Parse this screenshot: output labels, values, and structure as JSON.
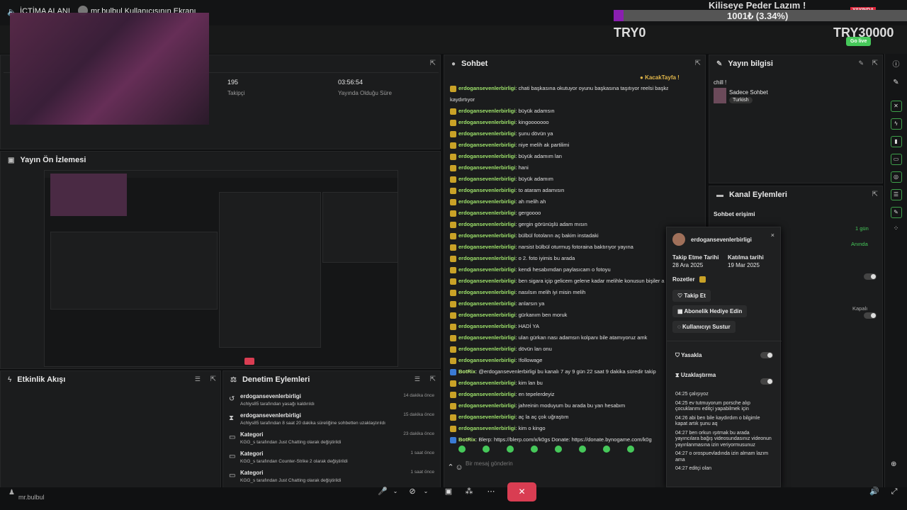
{
  "topbar": {
    "title": "İCTİMA ALANI",
    "user_screen": "mr.bulbul Kullanıcısının Ekranı"
  },
  "overlay": {
    "banner": "Kiliseye Peder Lazım !",
    "goal": "1001₺ (3.34%)",
    "left_amount": "TRY0",
    "right_amount": "TRY30000",
    "go_live": "Go live",
    "yayinda": "YAYINDA"
  },
  "stats": {
    "followers_value": "195",
    "followers_label": "Takipçi",
    "duration_value": "03:56:54",
    "duration_label": "Yayında Olduğu Süre"
  },
  "panels": {
    "preview_title": "Yayın Ön İzlemesi",
    "activity_title": "Etkinlik Akışı",
    "moderation_title": "Denetim Eylemleri",
    "chat_title": "Sohbet",
    "info_title": "Yayın bilgisi",
    "channel_actions_title": "Kanal Eylemleri"
  },
  "chat": {
    "pinned_user": "KacakTayfa",
    "placeholder": "Bir mesaj gönderin",
    "messages": [
      {
        "user": "erdogansevenlerbirligi",
        "text": "chati başkasına okutuyor oyunu başkasına taşıtıyor reelsi başkasına"
      },
      {
        "user": "",
        "text": "kaydırtıyor"
      },
      {
        "user": "erdogansevenlerbirligi",
        "text": "büyük adamsın"
      },
      {
        "user": "erdogansevenlerbirligi",
        "text": "kingooooooo"
      },
      {
        "user": "erdogansevenlerbirligi",
        "text": "şunu dövün ya"
      },
      {
        "user": "erdogansevenlerbirligi",
        "text": "niye melih ak partilimi"
      },
      {
        "user": "erdogansevenlerbirligi",
        "text": "büyük adamım lan"
      },
      {
        "user": "erdogansevenlerbirligi",
        "text": "hani"
      },
      {
        "user": "erdogansevenlerbirligi",
        "text": "büyük adamım"
      },
      {
        "user": "erdogansevenlerbirligi",
        "text": "to ataram adamısın"
      },
      {
        "user": "erdogansevenlerbirligi",
        "text": "ah melih ah"
      },
      {
        "user": "erdogansevenlerbirligi",
        "text": "gergoooo"
      },
      {
        "user": "erdogansevenlerbirligi",
        "text": "gergin görünüşlü adam mısın"
      },
      {
        "user": "erdogansevenlerbirligi",
        "text": "bülbül fotoların aç bakim instadaki"
      },
      {
        "user": "erdogansevenlerbirligi",
        "text": "narsist bülbül oturmuş fotoraina baktırıyor yayına"
      },
      {
        "user": "erdogansevenlerbirligi",
        "text": "o 2. foto iyimis bu arada"
      },
      {
        "user": "erdogansevenlerbirligi",
        "text": "kendi hesabımdan paylasıcam o fotoyu"
      },
      {
        "user": "erdogansevenlerbirligi",
        "text": "ben sigara içip gelicem gelene kadar melihle konusun bişiler a"
      },
      {
        "user": "erdogansevenlerbirligi",
        "text": "nasılsın melih iyi misin melih"
      },
      {
        "user": "erdogansevenlerbirligi",
        "text": "anlarsın ya"
      },
      {
        "user": "erdogansevenlerbirligi",
        "text": "gürkanım ben moruk"
      },
      {
        "user": "erdogansevenlerbirligi",
        "text": "HADİ YA"
      },
      {
        "user": "erdogansevenlerbirligi",
        "text": "ulan gürkan nası adamsın kolpanı bile atamıyoruz amk"
      },
      {
        "user": "erdogansevenlerbirligi",
        "text": "dövün lan onu"
      },
      {
        "user": "erdogansevenlerbirligi",
        "text": "!followage"
      },
      {
        "user": "BotRix",
        "text": "@erdogansevenlerbirligi bu kanalı 7 ay 9 gün 22 saat 9 dakika süredir takip"
      },
      {
        "user": "erdogansevenlerbirligi",
        "text": "kim lan bu"
      },
      {
        "user": "erdogansevenlerbirligi",
        "text": "en tepelerdeyiz"
      },
      {
        "user": "erdogansevenlerbirligi",
        "text": "jahreinin moduyum bu arada bu yan hesabım"
      },
      {
        "user": "erdogansevenlerbirligi",
        "text": "aç la aç çok uğraştım"
      },
      {
        "user": "erdogansevenlerbirligi",
        "text": "kim o kingo"
      },
      {
        "user": "BotRix",
        "text": "Blerp: https://blerp.com/x/k0gs Donate: https://donate.bynogame.com/k0g"
      }
    ]
  },
  "info": {
    "title_text": "chill !",
    "category": "Sadece Sohbet",
    "tag": "Turkish"
  },
  "channel_actions": {
    "chat_access": "Sohbet erişimi",
    "opt1": "1 gün",
    "opt2": "Anında",
    "opt3": "Kapalı"
  },
  "popup": {
    "username": "erdogansevenlerbirligi",
    "follow_date_label": "Takip Etme Tarihi",
    "follow_date": "28 Ara 2025",
    "join_date_label": "Katılma tarihi",
    "join_date": "19 Mar 2025",
    "badges_label": "Rozetler",
    "follow_btn": "Takip Et",
    "gift_btn": "Abonelik Hediye Edin",
    "mute_btn": "Kullanıcıyı Sustur",
    "ban_label": "Yasakla",
    "timeout_label": "Uzaklaştırma",
    "notes": [
      "04:25 çalışıyoz",
      "04:25 ev tutmuyorum porsche alıp çocuklarımı editçi yapabilmek için",
      "04:26 abi ben bile kaydırdım o bilgimle kapat artık şunu aq",
      "04:27 ben orkun ışıtmak bu arada yayıncılara bağış videosundasınız videonun yayınlanmasına izin veriyormusunuz",
      "04:27 o orospuevladında izin almam lazım ama",
      "04:27 editçi olan"
    ]
  },
  "moderation": [
    {
      "title": "erdogansevenlerbirligi",
      "detail": "Achlys85 tarafından yasağı kaldırıldı",
      "time": "14 dakika önce"
    },
    {
      "title": "erdogansevenlerbirligi",
      "detail": "Achlys85 tarafından 8 saat 20 dakika süreliğine sohbetten uzaklaştırıldı",
      "time": "15 dakika önce"
    },
    {
      "title": "Kategori",
      "detail": "KGG_s tarafından Just Chatting olarak değiştirildi",
      "time": "23 dakika önce"
    },
    {
      "title": "Kategori",
      "detail": "KGG_s tarafından Counter-Strike 2 olarak değiştirildi",
      "time": "1 saat önce"
    },
    {
      "title": "Kategori",
      "detail": "KGG_s tarafından Just Chatting olarak değiştirildi",
      "time": "1 saat önce"
    }
  ],
  "bottom": {
    "username": "mr.bulbul"
  },
  "colors": {
    "accent_green": "#46c85a",
    "red": "#d93d52",
    "live_red": "#e0243a"
  }
}
